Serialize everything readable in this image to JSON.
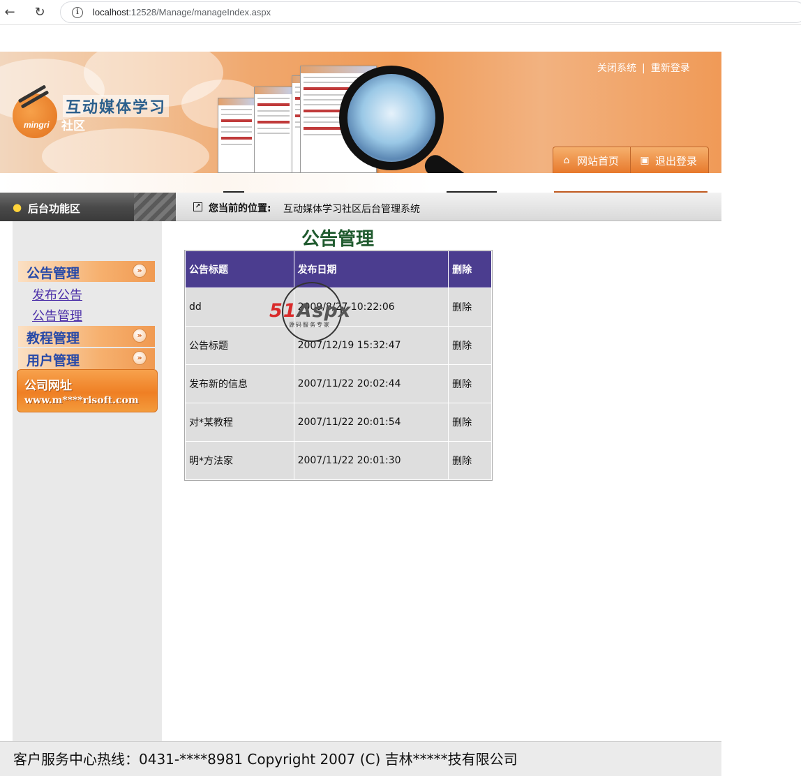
{
  "browser": {
    "url_host": "localhost",
    "url_path": ":12528/Manage/manageIndex.aspx"
  },
  "header": {
    "site_title": "互动媒体学习",
    "site_subtitle": "社区",
    "logo_text": "mingri",
    "close_system": "关闭系统",
    "separator": "|",
    "relogin": "重新登录",
    "home_tab": "网站首页",
    "logout_tab": "退出登录"
  },
  "location": {
    "func_area": "后台功能区",
    "label": "您当前的位置:",
    "value": "互动媒体学习社区后台管理系统"
  },
  "sidebar": {
    "groups": [
      {
        "label": "公告管理",
        "items": [
          "发布公告",
          "公告管理"
        ]
      },
      {
        "label": "教程管理",
        "items": []
      },
      {
        "label": "用户管理",
        "items": []
      }
    ],
    "company": {
      "title": "公司网址",
      "url": "www.m****risoft.com"
    }
  },
  "main": {
    "title": "公告管理",
    "table": {
      "headers": [
        "公告标题",
        "发布日期",
        "删除"
      ],
      "rows": [
        {
          "title": "dd",
          "date": "2009/8/27 10:22:06",
          "action": "删除"
        },
        {
          "title": "公告标题",
          "date": "2007/12/19 15:32:47",
          "action": "删除"
        },
        {
          "title": "发布新的信息",
          "date": "2007/11/22 20:02:44",
          "action": "删除"
        },
        {
          "title": "对*某教程",
          "date": "2007/11/22 20:01:54",
          "action": "删除"
        },
        {
          "title": "明*方法家",
          "date": "2007/11/22 20:01:30",
          "action": "删除"
        }
      ]
    },
    "watermark": {
      "num": "51",
      "word": "Aspx",
      "sub": "源码服务专家"
    }
  },
  "footer": {
    "text": "客户服务中心热线：0431-****8981 Copyright 2007 (C) 吉林*****技有限公司"
  }
}
